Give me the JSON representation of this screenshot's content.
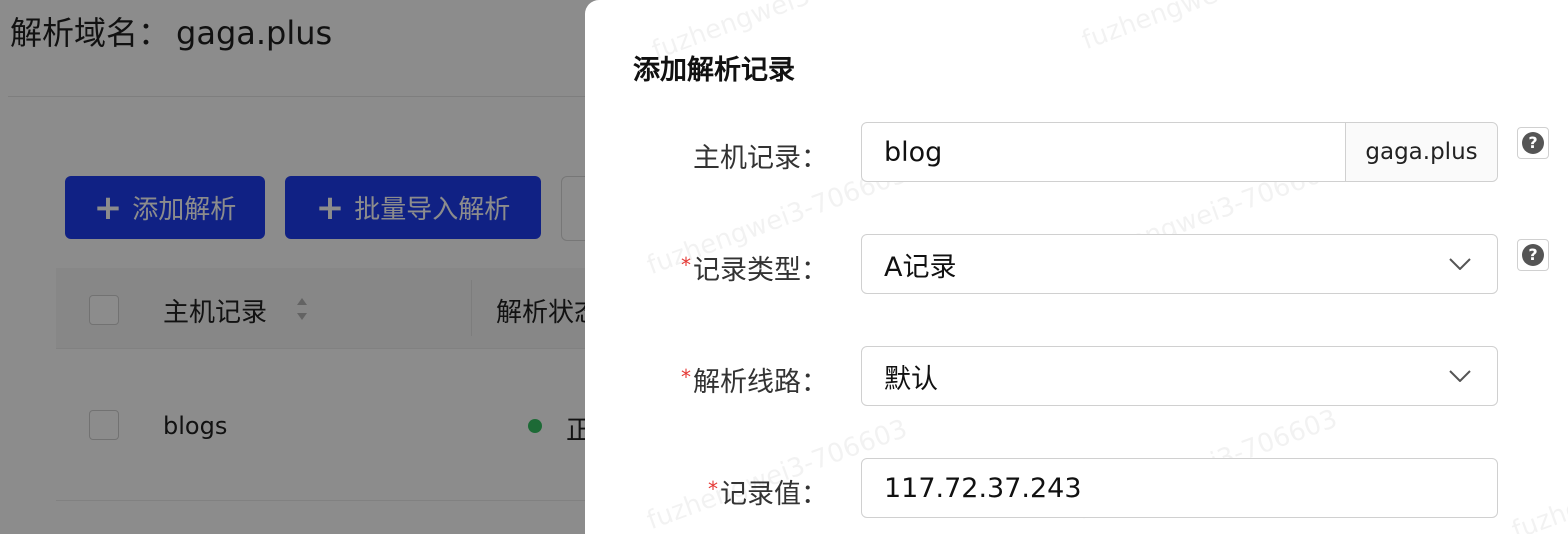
{
  "background": {
    "title_prefix": "解析域名：",
    "domain": "gaga.plus",
    "buttons": {
      "add_label": "添加解析",
      "batch_label": "批量导入解析"
    },
    "table": {
      "columns": [
        "主机记录",
        "解析状态"
      ],
      "rows": [
        {
          "host": "blogs",
          "status": "正"
        }
      ]
    },
    "status_color": "#35c263",
    "primary_color": "#1e3df0"
  },
  "modal": {
    "title": "添加解析记录",
    "watermark": "fuzhengwei3-706603",
    "fields": {
      "host_record": {
        "label": "主机记录：",
        "value": "blog",
        "suffix": "gaga.plus",
        "required": false
      },
      "record_type": {
        "label": "记录类型：",
        "value": "A记录",
        "required": true
      },
      "line": {
        "label": "解析线路：",
        "value": "默认",
        "required": true
      },
      "record_value": {
        "label": "记录值：",
        "value": "117.72.37.243",
        "required": true
      }
    },
    "required_mark": "*",
    "help_glyph": "?"
  }
}
